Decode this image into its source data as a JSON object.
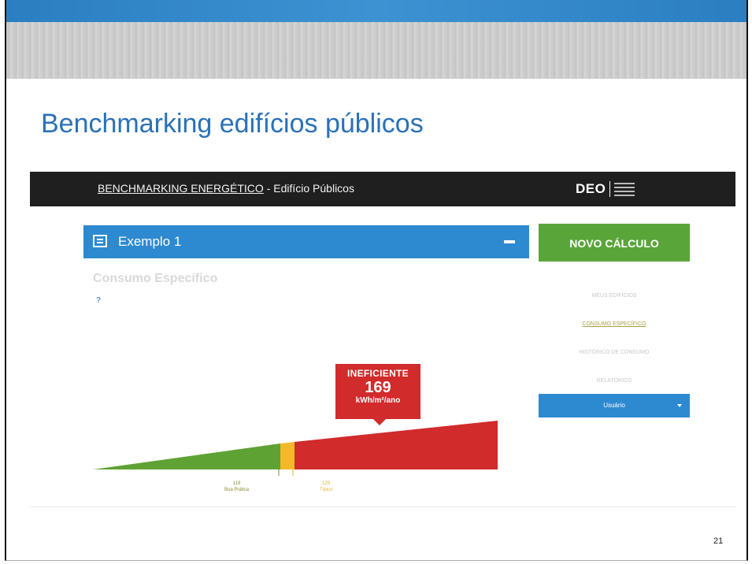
{
  "slide": {
    "title": "Benchmarking edifícios públicos",
    "page_number": "21"
  },
  "app": {
    "header": {
      "title_link": "BENCHMARKING ENERGÉTICO",
      "title_rest": " - Edifício Públicos",
      "logo_text": "DEO"
    },
    "card": {
      "title": "Exemplo 1",
      "collapse_icon": "minus-icon",
      "building_icon": "building-icon"
    },
    "new_calc_label": "NOVO CÁLCULO",
    "section_title": "Consumo Específico",
    "help_icon": "?",
    "sidebar_links": [
      {
        "label": "MEUS EDIFÍCIOS",
        "active": false
      },
      {
        "label": "CONSUMO ESPECÍFICO",
        "active": true
      },
      {
        "label": "HISTÓRICO DE CONSUMO",
        "active": false
      },
      {
        "label": "RELATÓRIOS",
        "active": false
      }
    ],
    "user_select": "Usuário",
    "rating": {
      "label": "INEFICIENTE",
      "value": "169",
      "unit": "kWh/m²/ano"
    },
    "thresholds": {
      "good_value": "119",
      "good_label": "Boa Prática",
      "avg_value": "129",
      "avg_label": "Típico"
    },
    "colors": {
      "green": "#5fa234",
      "yellow": "#f4b92a",
      "red": "#d12b2b",
      "accent_blue": "#2d8ad0"
    }
  }
}
